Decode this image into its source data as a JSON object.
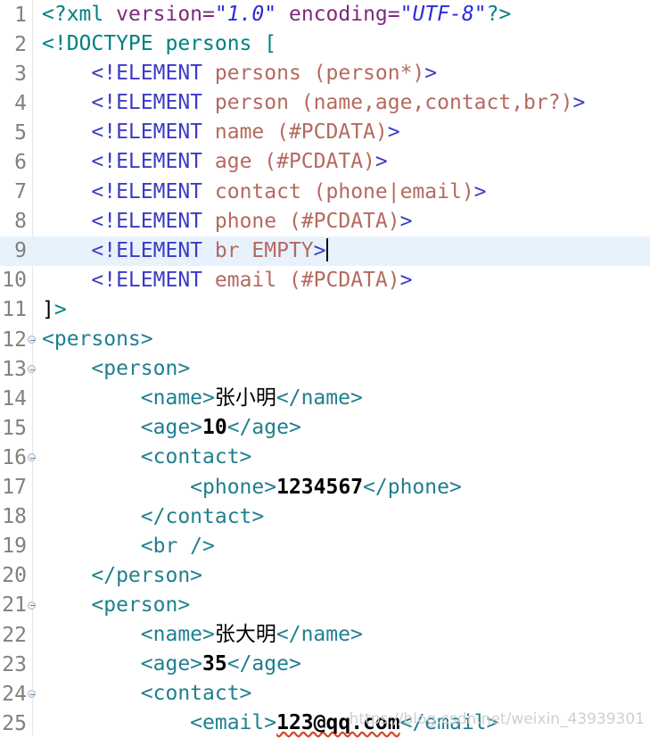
{
  "editor": {
    "language": "XML",
    "current_line": 9,
    "caret_line": 9,
    "colors": {
      "background": "#ffffff",
      "current_line_highlight": "#e8f2fd",
      "gutter_text": "#808080",
      "processing_instruction": "#008080",
      "attribute_name": "#7d2a7d",
      "attribute_value": "#2a2adf",
      "doctype": "#008080",
      "dtd_declaration": "#3b3bc4",
      "dtd_name": "#b5695f",
      "xml_tag": "#1f7f8f",
      "text_content": "#000000",
      "spell_error_underline": "#d04a2a",
      "fold_marker": "#9fb6cc"
    },
    "lines": [
      {
        "number": "1",
        "fold": false,
        "tokens": [
          {
            "text": "<?xml ",
            "type": "pi"
          },
          {
            "text": "version",
            "type": "attr"
          },
          {
            "text": "=",
            "type": "eq"
          },
          {
            "text": "\"1.0\"",
            "type": "str"
          },
          {
            "text": " ",
            "type": "plain"
          },
          {
            "text": "encoding",
            "type": "attr"
          },
          {
            "text": "=",
            "type": "eq"
          },
          {
            "text": "\"UTF-8\"",
            "type": "str"
          },
          {
            "text": "?>",
            "type": "pi"
          }
        ]
      },
      {
        "number": "2",
        "fold": false,
        "tokens": [
          {
            "text": "<!DOCTYPE persons [",
            "type": "doctype"
          }
        ]
      },
      {
        "number": "3",
        "fold": false,
        "tokens": [
          {
            "text": "    ",
            "type": "plain"
          },
          {
            "text": "<!ELEMENT ",
            "type": "decl"
          },
          {
            "text": "persons (person*)",
            "type": "dname"
          },
          {
            "text": ">",
            "type": "decl"
          }
        ]
      },
      {
        "number": "4",
        "fold": false,
        "tokens": [
          {
            "text": "    ",
            "type": "plain"
          },
          {
            "text": "<!ELEMENT ",
            "type": "decl"
          },
          {
            "text": "person (name,age,contact,br?)",
            "type": "dname"
          },
          {
            "text": ">",
            "type": "decl"
          }
        ]
      },
      {
        "number": "5",
        "fold": false,
        "tokens": [
          {
            "text": "    ",
            "type": "plain"
          },
          {
            "text": "<!ELEMENT ",
            "type": "decl"
          },
          {
            "text": "name (#PCDATA)",
            "type": "dname"
          },
          {
            "text": ">",
            "type": "decl"
          }
        ]
      },
      {
        "number": "6",
        "fold": false,
        "tokens": [
          {
            "text": "    ",
            "type": "plain"
          },
          {
            "text": "<!ELEMENT ",
            "type": "decl"
          },
          {
            "text": "age (#PCDATA)",
            "type": "dname"
          },
          {
            "text": ">",
            "type": "decl"
          }
        ]
      },
      {
        "number": "7",
        "fold": false,
        "tokens": [
          {
            "text": "    ",
            "type": "plain"
          },
          {
            "text": "<!ELEMENT ",
            "type": "decl"
          },
          {
            "text": "contact (phone|email)",
            "type": "dname"
          },
          {
            "text": ">",
            "type": "decl"
          }
        ]
      },
      {
        "number": "8",
        "fold": false,
        "tokens": [
          {
            "text": "    ",
            "type": "plain"
          },
          {
            "text": "<!ELEMENT ",
            "type": "decl"
          },
          {
            "text": "phone (#PCDATA)",
            "type": "dname"
          },
          {
            "text": ">",
            "type": "decl"
          }
        ]
      },
      {
        "number": "9",
        "fold": false,
        "current": true,
        "caret": true,
        "tokens": [
          {
            "text": "    ",
            "type": "plain"
          },
          {
            "text": "<!ELEMENT ",
            "type": "decl"
          },
          {
            "text": "br EMPTY",
            "type": "dname"
          },
          {
            "text": ">",
            "type": "decl"
          }
        ]
      },
      {
        "number": "10",
        "fold": false,
        "tokens": [
          {
            "text": "    ",
            "type": "plain"
          },
          {
            "text": "<!ELEMENT ",
            "type": "decl"
          },
          {
            "text": "email (#PCDATA)",
            "type": "dname"
          },
          {
            "text": ">",
            "type": "decl"
          }
        ]
      },
      {
        "number": "11",
        "fold": false,
        "tokens": [
          {
            "text": "]",
            "type": "bracket"
          },
          {
            "text": ">",
            "type": "doctype"
          }
        ]
      },
      {
        "number": "12",
        "fold": true,
        "tokens": [
          {
            "text": "<persons>",
            "type": "tag"
          }
        ]
      },
      {
        "number": "13",
        "fold": true,
        "tokens": [
          {
            "text": "    ",
            "type": "plain"
          },
          {
            "text": "<person>",
            "type": "tag"
          }
        ]
      },
      {
        "number": "14",
        "fold": false,
        "tokens": [
          {
            "text": "        ",
            "type": "plain"
          },
          {
            "text": "<name>",
            "type": "tag"
          },
          {
            "text": "张小明",
            "type": "text-cn"
          },
          {
            "text": "</name>",
            "type": "tag"
          }
        ]
      },
      {
        "number": "15",
        "fold": false,
        "tokens": [
          {
            "text": "        ",
            "type": "plain"
          },
          {
            "text": "<age>",
            "type": "tag"
          },
          {
            "text": "10",
            "type": "text"
          },
          {
            "text": "</age>",
            "type": "tag"
          }
        ]
      },
      {
        "number": "16",
        "fold": true,
        "tokens": [
          {
            "text": "        ",
            "type": "plain"
          },
          {
            "text": "<contact>",
            "type": "tag"
          }
        ]
      },
      {
        "number": "17",
        "fold": false,
        "tokens": [
          {
            "text": "            ",
            "type": "plain"
          },
          {
            "text": "<phone>",
            "type": "tag"
          },
          {
            "text": "1234567",
            "type": "text"
          },
          {
            "text": "</phone>",
            "type": "tag"
          }
        ]
      },
      {
        "number": "18",
        "fold": false,
        "tokens": [
          {
            "text": "        ",
            "type": "plain"
          },
          {
            "text": "</contact>",
            "type": "tag"
          }
        ]
      },
      {
        "number": "19",
        "fold": false,
        "tokens": [
          {
            "text": "        ",
            "type": "plain"
          },
          {
            "text": "<br />",
            "type": "tag"
          }
        ]
      },
      {
        "number": "20",
        "fold": false,
        "tokens": [
          {
            "text": "    ",
            "type": "plain"
          },
          {
            "text": "</person>",
            "type": "tag"
          }
        ]
      },
      {
        "number": "21",
        "fold": true,
        "tokens": [
          {
            "text": "    ",
            "type": "plain"
          },
          {
            "text": "<person>",
            "type": "tag"
          }
        ]
      },
      {
        "number": "22",
        "fold": false,
        "tokens": [
          {
            "text": "        ",
            "type": "plain"
          },
          {
            "text": "<name>",
            "type": "tag"
          },
          {
            "text": "张大明",
            "type": "text-cn"
          },
          {
            "text": "</name>",
            "type": "tag"
          }
        ]
      },
      {
        "number": "23",
        "fold": false,
        "tokens": [
          {
            "text": "        ",
            "type": "plain"
          },
          {
            "text": "<age>",
            "type": "tag"
          },
          {
            "text": "35",
            "type": "text"
          },
          {
            "text": "</age>",
            "type": "tag"
          }
        ]
      },
      {
        "number": "24",
        "fold": true,
        "tokens": [
          {
            "text": "        ",
            "type": "plain"
          },
          {
            "text": "<contact>",
            "type": "tag"
          }
        ]
      },
      {
        "number": "25",
        "fold": false,
        "tokens": [
          {
            "text": "            ",
            "type": "plain"
          },
          {
            "text": "<email>",
            "type": "tag"
          },
          {
            "text": "123@qq.com",
            "type": "text",
            "spell_error": true
          },
          {
            "text": "</email>",
            "type": "tag"
          }
        ]
      }
    ]
  },
  "watermark": {
    "text": "https://blog.csdn.net/weixin_43939301"
  }
}
